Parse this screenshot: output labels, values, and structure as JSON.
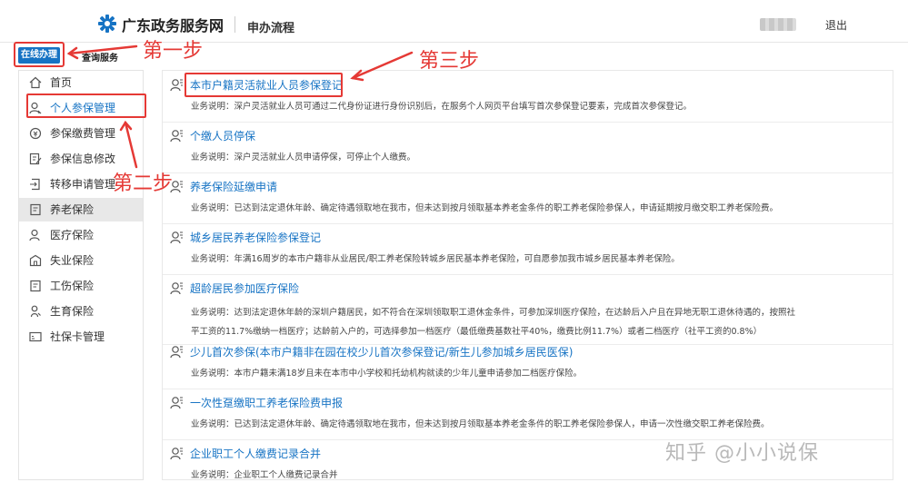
{
  "header": {
    "site_name": "广东政务服务网",
    "page_name": "申办流程",
    "logout_label": "退出"
  },
  "tabs": {
    "online": "在线办理",
    "query": "查询服务"
  },
  "sidebar": {
    "items": [
      {
        "label": "首页",
        "icon": "home-icon"
      },
      {
        "label": "个人参保管理",
        "icon": "person-icon"
      },
      {
        "label": "参保缴费管理",
        "icon": "coin-icon"
      },
      {
        "label": "参保信息修改",
        "icon": "edit-doc-icon"
      },
      {
        "label": "转移申请管理",
        "icon": "transfer-icon"
      },
      {
        "label": "养老保险",
        "icon": "document-icon"
      },
      {
        "label": "医疗保险",
        "icon": "medical-person-icon"
      },
      {
        "label": "失业保险",
        "icon": "building-icon"
      },
      {
        "label": "工伤保险",
        "icon": "document-icon"
      },
      {
        "label": "生育保险",
        "icon": "baby-icon"
      },
      {
        "label": "社保卡管理",
        "icon": "card-icon"
      }
    ]
  },
  "content": {
    "entries": [
      {
        "title": "本市户籍灵活就业人员参保登记",
        "desc": [
          "业务说明：深户灵活就业人员可通过二代身份证进行身份识别后，在服务个人网页平台填写首次参保登记要素，完成首次参保登记。"
        ]
      },
      {
        "title": "个缴人员停保",
        "desc": [
          "业务说明：深户灵活就业人员申请停保，可停止个人缴费。"
        ]
      },
      {
        "title": "养老保险延缴申请",
        "desc": [
          "业务说明：已达到法定退休年龄、确定待遇领取地在我市，但未达到按月领取基本养老金条件的职工养老保险参保人，申请延期按月缴交职工养老保险费。"
        ]
      },
      {
        "title": "城乡居民养老保险参保登记",
        "desc": [
          "业务说明：年满16周岁的本市户籍非从业居民/职工养老保险转城乡居民基本养老保险，可自愿参加我市城乡居民基本养老保险。"
        ]
      },
      {
        "title": "超龄居民参加医疗保险",
        "desc": [
          "业务说明：达到法定退休年龄的深圳户籍居民，如不符合在深圳领取职工退休金条件，可参加深圳医疗保险，在达龄后入户且在异地无职工退休待遇的，按照社",
          "平工资的11.7%缴纳一档医疗；达龄前入户的，可选择参加一档医疗（最低缴费基数社平40%，缴费比例11.7%）或者二档医疗（社平工资的0.8%）"
        ]
      },
      {
        "title": "少儿首次参保(本市户籍非在园在校少儿首次参保登记/新生儿参加城乡居民医保)",
        "desc": [
          "业务说明：本市户籍未满18岁且未在本市中小学校和托幼机构就读的少年儿童申请参加二档医疗保险。"
        ]
      },
      {
        "title": "一次性趸缴职工养老保险费申报",
        "desc": [
          "业务说明：已达到法定退休年龄、确定待遇领取地在我市，但未达到按月领取基本养老金条件的职工养老保险参保人，申请一次性缴交职工养老保险费。"
        ]
      },
      {
        "title": "企业职工个人缴费记录合并",
        "desc": [
          "业务说明：企业职工个人缴费记录合并"
        ]
      }
    ]
  },
  "annotations": {
    "step1": "第一步",
    "step2": "第二步",
    "step3": "第三步"
  },
  "watermark": "知乎 @小小说保",
  "colors": {
    "accent": "#1673c4",
    "annotation": "#e53935",
    "active_bg": "#e8e8e8"
  }
}
